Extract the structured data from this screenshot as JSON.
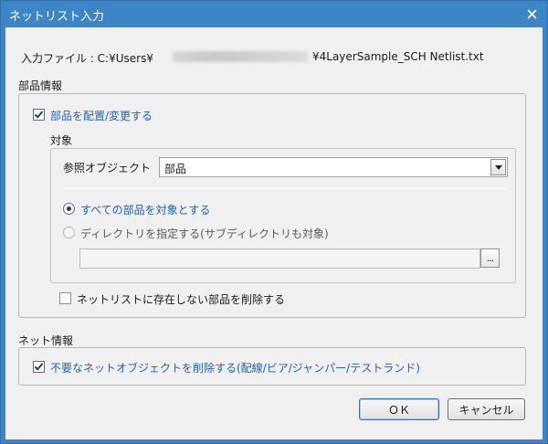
{
  "window": {
    "title": "ネットリスト入力"
  },
  "file": {
    "label": "入力ファイル : C:¥Users¥",
    "name": "¥4LayerSample_SCH Netlist.txt"
  },
  "parts": {
    "section_label": "部品情報",
    "place_change": {
      "label": "部品を配置/変更する",
      "checked": true
    },
    "target": {
      "label": "対象",
      "ref_object": {
        "label": "参照オブジェクト",
        "value": "部品"
      },
      "all_parts": {
        "label": "すべての部品を対象とする",
        "selected": true
      },
      "directory": {
        "label": "ディレクトリを指定する(サブディレクトリも対象)",
        "selected": false,
        "value": ""
      },
      "browse_label": "..."
    },
    "delete_not_in_netlist": {
      "label": "ネットリストに存在しない部品を削除する",
      "checked": false
    }
  },
  "net": {
    "section_label": "ネット情報",
    "delete_unused": {
      "label": "不要なネットオブジェクトを削除する(配線/ビア/ジャンパー/テストランド)",
      "checked": true
    }
  },
  "buttons": {
    "ok": "ＯＫ",
    "cancel": "キャンセル"
  },
  "icons": {
    "close": "close-icon",
    "check": "check-icon",
    "dropdown": "chevron-down-icon"
  },
  "colors": {
    "titlebar": "#3c86c8",
    "dialog_bg": "#f0f0f0",
    "link_text": "#1f63b4"
  }
}
